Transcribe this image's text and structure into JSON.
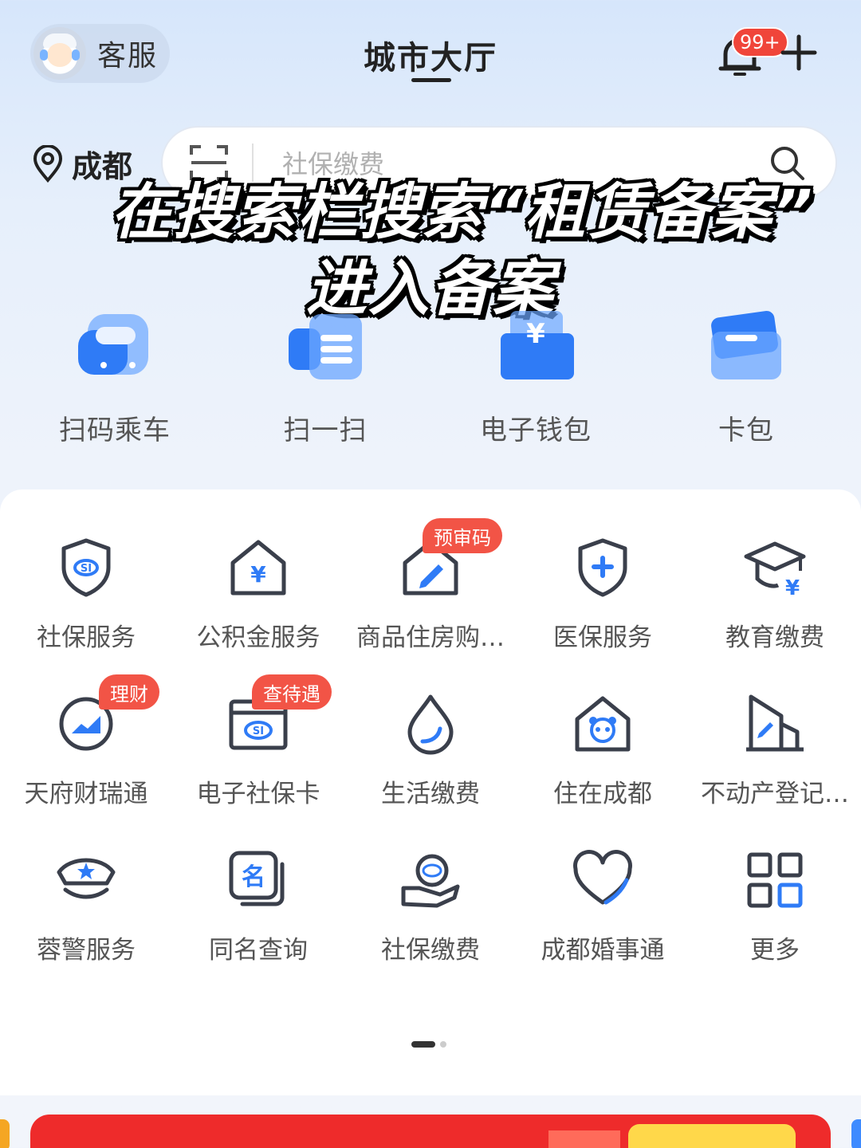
{
  "header": {
    "customer_service": "客服",
    "title": "城市大厅",
    "notification_badge": "99+"
  },
  "location": {
    "city": "成都"
  },
  "search": {
    "placeholder": "社保缴费"
  },
  "caption": {
    "line1": "在搜索栏搜索“租赁备案”",
    "line2": "进入备案"
  },
  "shortcuts": [
    {
      "label": "扫码乘车",
      "icon": "bus-icon"
    },
    {
      "label": "扫一扫",
      "icon": "scan-icon"
    },
    {
      "label": "电子钱包",
      "icon": "wallet-icon"
    },
    {
      "label": "卡包",
      "icon": "card-icon"
    }
  ],
  "services": [
    {
      "label": "社保服务",
      "icon": "social-security-shield-icon"
    },
    {
      "label": "公积金服务",
      "icon": "housing-fund-icon"
    },
    {
      "label": "商品住房购…",
      "icon": "house-purchase-icon",
      "tag": "预审码"
    },
    {
      "label": "医保服务",
      "icon": "medical-insurance-icon"
    },
    {
      "label": "教育缴费",
      "icon": "education-payment-icon"
    },
    {
      "label": "天府财瑞通",
      "icon": "finance-icon",
      "tag": "理财"
    },
    {
      "label": "电子社保卡",
      "icon": "social-security-card-icon",
      "tag": "查待遇"
    },
    {
      "label": "生活缴费",
      "icon": "water-drop-icon"
    },
    {
      "label": "住在成都",
      "icon": "panda-house-icon"
    },
    {
      "label": "不动产登记…",
      "icon": "real-estate-icon"
    },
    {
      "label": "蓉警服务",
      "icon": "police-cap-icon"
    },
    {
      "label": "同名查询",
      "icon": "name-query-icon"
    },
    {
      "label": "社保缴费",
      "icon": "social-security-payment-icon"
    },
    {
      "label": "成都婚事通",
      "icon": "heart-icon"
    },
    {
      "label": "更多",
      "icon": "more-grid-icon"
    }
  ],
  "colors": {
    "accent_blue": "#2f7bf6",
    "tag_red": "#f25446",
    "icon_stroke": "#3a3f4b"
  }
}
